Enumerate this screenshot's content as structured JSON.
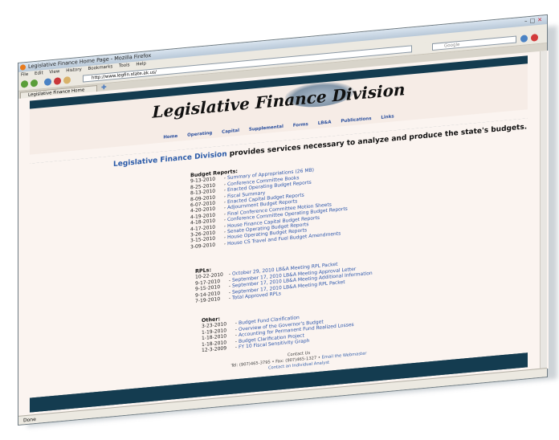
{
  "browser": {
    "window_title": "Legislative Finance Home Page - Mozilla Firefox",
    "menu": [
      "File",
      "Edit",
      "View",
      "History",
      "Bookmarks",
      "Tools",
      "Help"
    ],
    "url": "http://www.legfin.state.ak.us/",
    "search_placeholder": "Google",
    "tab_title": "Legislative Finance Home Page",
    "status": "Done"
  },
  "site": {
    "title": "Legislative Finance Division",
    "nav": [
      "Home",
      "Operating",
      "Capital",
      "Supplemental",
      "Forms",
      "LB&A",
      "Publications",
      "Links"
    ],
    "tagline_link": "Legislative Finance Division",
    "tagline_rest": " provides services necessary to analyze and produce the state's budgets."
  },
  "budget_reports": {
    "heading": "Budget Reports:",
    "items": [
      {
        "date": "9-13-2010",
        "text": "Summary of Appropriations (26 MB)"
      },
      {
        "date": "8-25-2010",
        "text": "Conference Committee Books"
      },
      {
        "date": "8-13-2010",
        "text": "Enacted Operating Budget Reports"
      },
      {
        "date": "8-09-2010",
        "text": "Fiscal Summary"
      },
      {
        "date": "6-07-2010",
        "text": "Enacted Capital Budget Reports"
      },
      {
        "date": "4-20-2010",
        "text": "Adjournment Budget Reports"
      },
      {
        "date": "4-19-2010",
        "text": "Final Conference Committee Motion Sheets"
      },
      {
        "date": "4-18-2010",
        "text": "Conference Committee Operating Budget Reports"
      },
      {
        "date": "4-17-2010",
        "text": "House Finance Capital Budget Reports"
      },
      {
        "date": "3-26-2010",
        "text": "Senate Operating Budget Reports"
      },
      {
        "date": "3-15-2010",
        "text": "House Operating Budget Reports"
      },
      {
        "date": "3-09-2010",
        "text": "House CS Travel and Fuel Budget Amendments"
      }
    ]
  },
  "rpls": {
    "heading": "RPLs:",
    "items": [
      {
        "date": "10-22-2010",
        "text": "October 29, 2010 LB&A Meeting RPL Packet"
      },
      {
        "date": "9-17-2010",
        "text": "September 17, 2010 LB&A Meeting Approval Letter"
      },
      {
        "date": "9-15-2010",
        "text": "September 17, 2010 LB&A Meeting Additional Information"
      },
      {
        "date": "9-14-2010",
        "text": "September 17, 2010 LB&A Meeting RPL Packet"
      },
      {
        "date": "7-19-2010",
        "text": "Total Approved RPLs"
      }
    ]
  },
  "other": {
    "heading": "Other:",
    "items": [
      {
        "date": "3-23-2010",
        "text": "Budget Fund Clarification"
      },
      {
        "date": "1-19-2010",
        "text": "Overview of the Governor's Budget"
      },
      {
        "date": "1-18-2010",
        "text": "Accounting for Permanent Fund Realized Losses"
      },
      {
        "date": "1-18-2010",
        "text": "Budget Clarification Project"
      },
      {
        "date": "12-3-2009",
        "text": "FY 10 Fiscal Sensitivity Graph"
      }
    ]
  },
  "contact": {
    "heading": "Contact Us",
    "phone": "Tel: (907)465-3795 • Fax: (907)465-1327 •",
    "email_link": "Email the Webmaster",
    "analyst_link": "Contact an Individual Analyst"
  }
}
